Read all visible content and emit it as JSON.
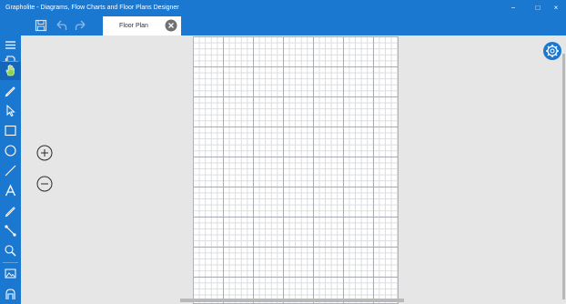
{
  "window": {
    "title": "Grapholite - Diagrams, Flow Charts and Floor Plans Designer",
    "controls": {
      "minimize": "−",
      "maximize": "□",
      "close": "×"
    },
    "accent_color": "#1b78d0"
  },
  "toolbar": {
    "buttons": [
      {
        "name": "save",
        "icon": "save-icon"
      },
      {
        "name": "undo",
        "icon": "undo-icon"
      },
      {
        "name": "redo",
        "icon": "redo-icon"
      }
    ]
  },
  "tab": {
    "label": "Floor Plan",
    "close_icon": "close-circle-icon"
  },
  "sidebar": {
    "items": [
      {
        "name": "menu",
        "icon": "hamburger-icon"
      },
      {
        "name": "pages",
        "icon": "pages-icon"
      },
      {
        "name": "pan",
        "icon": "hand-icon"
      },
      {
        "name": "pen",
        "icon": "pen-icon"
      },
      {
        "name": "select",
        "icon": "pointer-icon"
      },
      {
        "name": "rectangle",
        "icon": "rectangle-icon"
      },
      {
        "name": "ellipse",
        "icon": "ellipse-icon"
      },
      {
        "name": "line",
        "icon": "line-icon"
      },
      {
        "name": "text",
        "icon": "text-icon"
      },
      {
        "name": "pencil",
        "icon": "pencil-icon"
      },
      {
        "name": "connector",
        "icon": "connector-icon"
      },
      {
        "name": "zoom",
        "icon": "magnifier-icon"
      },
      {
        "name": "image",
        "icon": "image-icon"
      },
      {
        "name": "library",
        "icon": "library-icon"
      }
    ]
  },
  "canvas": {
    "zoom_in_icon": "plus-circle-icon",
    "zoom_out_icon": "minus-circle-icon",
    "settings_icon": "gear-icon"
  }
}
